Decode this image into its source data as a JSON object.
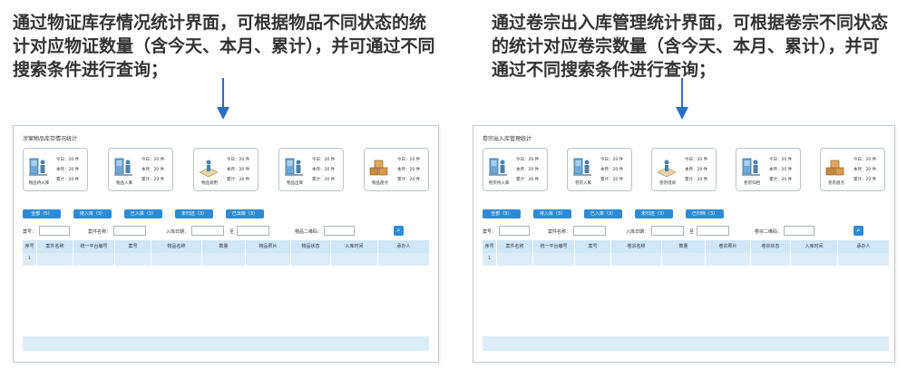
{
  "captions": {
    "left": "通过物证库存情况统计界面，可根据物品不同状态的统计对应物证数量（含今天、本月、累计），并可通过不同搜索条件进行查询；",
    "right": "通过卷宗出入库管理统计界面，可根据卷宗不同状态的统计对应卷宗数量（含今天、本月、累计），并可通过不同搜索条件进行查询；"
  },
  "colors": {
    "accent": "#2d8bd6",
    "arrow": "#2c6fc2",
    "table_header": "#cfe7f8",
    "table_row": "#dcedf9"
  },
  "left_panel": {
    "title": "涉案物品库存情况统计",
    "cards": [
      {
        "label": "物品待入库",
        "icon": "locker-person-icon",
        "today": "今日：20  件",
        "month": "本月：20  件",
        "total": "累计：20  件"
      },
      {
        "label": "物品入库",
        "icon": "locker-person-icon",
        "today": "今日：20  件",
        "month": "本月：20  件",
        "total": "累计：20  件"
      },
      {
        "label": "物品调用",
        "icon": "map-person-icon",
        "today": "今日：20  件",
        "month": "本月：20  件",
        "total": "累计：20  件"
      },
      {
        "label": "物品出库",
        "icon": "locker-person-icon",
        "today": "今日：20  件",
        "month": "本月：20  件",
        "total": "累计：20  件"
      },
      {
        "label": "物品盘点",
        "icon": "boxes-icon",
        "today": "今日：20  件",
        "month": "本月：20  件",
        "total": "累计：20  件"
      }
    ],
    "filters": [
      "全部（5）",
      "待入库（3）",
      "已入库（3）",
      "未归还（3）",
      "已出库（3）"
    ],
    "search": {
      "field1": "案号：",
      "field2": "案件名称：",
      "field3": "入库日期：",
      "separator": "至",
      "field4": "物品二维码："
    },
    "columns": [
      "序号",
      "案件名称",
      "统一平台编号",
      "案号",
      "物品名称",
      "数量",
      "物品照片",
      "物品状态",
      "入库时间",
      "承办人"
    ],
    "rows": [
      [
        "1",
        "",
        "",
        "",
        "",
        "",
        "",
        "",
        "",
        ""
      ]
    ]
  },
  "right_panel": {
    "title": "卷宗出入库管理统计",
    "cards": [
      {
        "label": "卷宗待入库",
        "icon": "locker-person-icon",
        "today": "今日：20  件",
        "month": "本月：20  件",
        "total": "累计：20  件"
      },
      {
        "label": "卷宗入库",
        "icon": "locker-person-icon",
        "today": "今日：20  件",
        "month": "本月：20  件",
        "total": "累计：20  件"
      },
      {
        "label": "卷宗借阅",
        "icon": "map-person-icon",
        "today": "今日：20  件",
        "month": "本月：20  件",
        "total": "累计：20  件"
      },
      {
        "label": "卷宗归档",
        "icon": "locker-person-icon",
        "today": "今日：20  件",
        "month": "本月：20  件",
        "total": "累计：20  件"
      },
      {
        "label": "卷宗盘点",
        "icon": "boxes-icon",
        "today": "今日：20  件",
        "month": "本月：20  件",
        "total": "累计：20  件"
      }
    ],
    "filters": [
      "全部（5）",
      "待入库（3）",
      "已入库（3）",
      "未归还（3）",
      "已归档（3）"
    ],
    "search": {
      "field1": "案号：",
      "field2": "案件名称：",
      "field3": "入库日期：",
      "separator": "至",
      "field4": "卷宗二维码："
    },
    "columns": [
      "序号",
      "案件名称",
      "统一平台编号",
      "案号",
      "卷宗名称",
      "数量",
      "卷宗照片",
      "卷宗状态",
      "入库时间",
      "承办人"
    ],
    "rows": [
      [
        "1",
        "",
        "",
        "",
        "",
        "",
        "",
        "",
        "",
        ""
      ]
    ]
  }
}
